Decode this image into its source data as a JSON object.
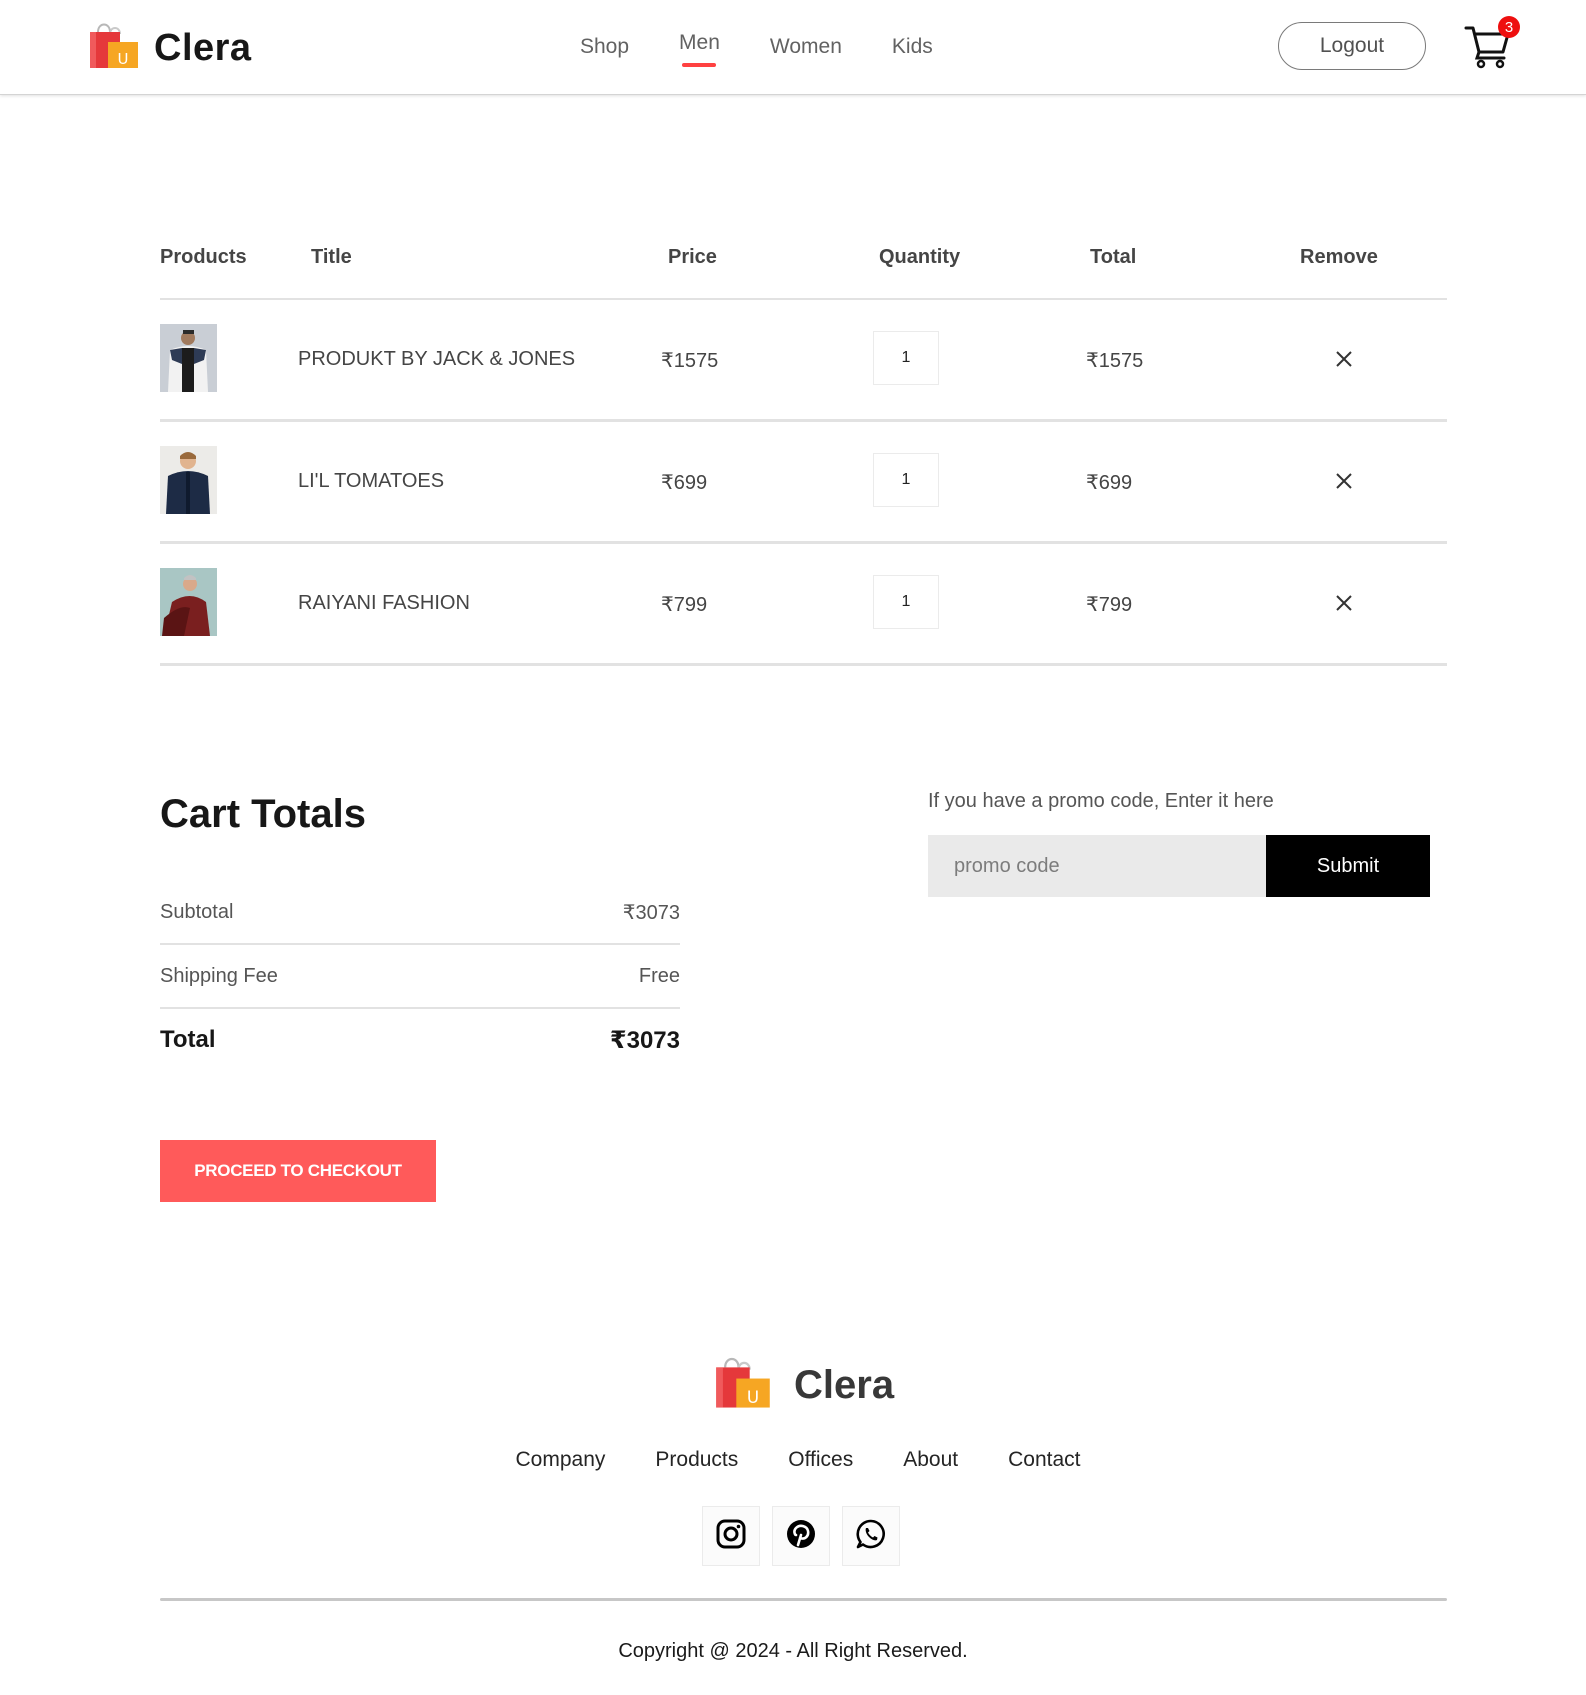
{
  "brand": {
    "name": "Clera",
    "bag_letter": "U"
  },
  "nav": {
    "items": [
      {
        "label": "Shop",
        "active": false
      },
      {
        "label": "Men",
        "active": true
      },
      {
        "label": "Women",
        "active": false
      },
      {
        "label": "Kids",
        "active": false
      }
    ],
    "logout_label": "Logout",
    "cart_count": "3"
  },
  "cart": {
    "headers": [
      "Products",
      "Title",
      "Price",
      "Quantity",
      "Total",
      "Remove"
    ],
    "rows": [
      {
        "title": "PRODUKT BY JACK & JONES",
        "price": "₹1575",
        "quantity": "1",
        "total": "₹1575"
      },
      {
        "title": "LI'L TOMATOES",
        "price": "₹699",
        "quantity": "1",
        "total": "₹699"
      },
      {
        "title": "RAIYANI FASHION",
        "price": "₹799",
        "quantity": "1",
        "total": "₹799"
      }
    ]
  },
  "totals": {
    "heading": "Cart Totals",
    "subtotal_label": "Subtotal",
    "subtotal_value": "₹3073",
    "shipping_label": "Shipping Fee",
    "shipping_value": "Free",
    "total_label": "Total",
    "total_value": "₹3073",
    "checkout_label": "PROCEED TO CHECKOUT"
  },
  "promo": {
    "label": "If you have a promo code, Enter it here",
    "placeholder": "promo code",
    "submit_label": "Submit"
  },
  "footer": {
    "links": [
      "Company",
      "Products",
      "Offices",
      "About",
      "Contact"
    ],
    "socials": [
      "instagram-icon",
      "pinterest-icon",
      "whatsapp-icon"
    ],
    "copyright": "Copyright @ 2024 - All Right Reserved."
  },
  "colors": {
    "accent": "#ff4141",
    "checkout_button": "#ff5a5a",
    "submit_button": "#000000",
    "badge": "#ee0f0f"
  }
}
